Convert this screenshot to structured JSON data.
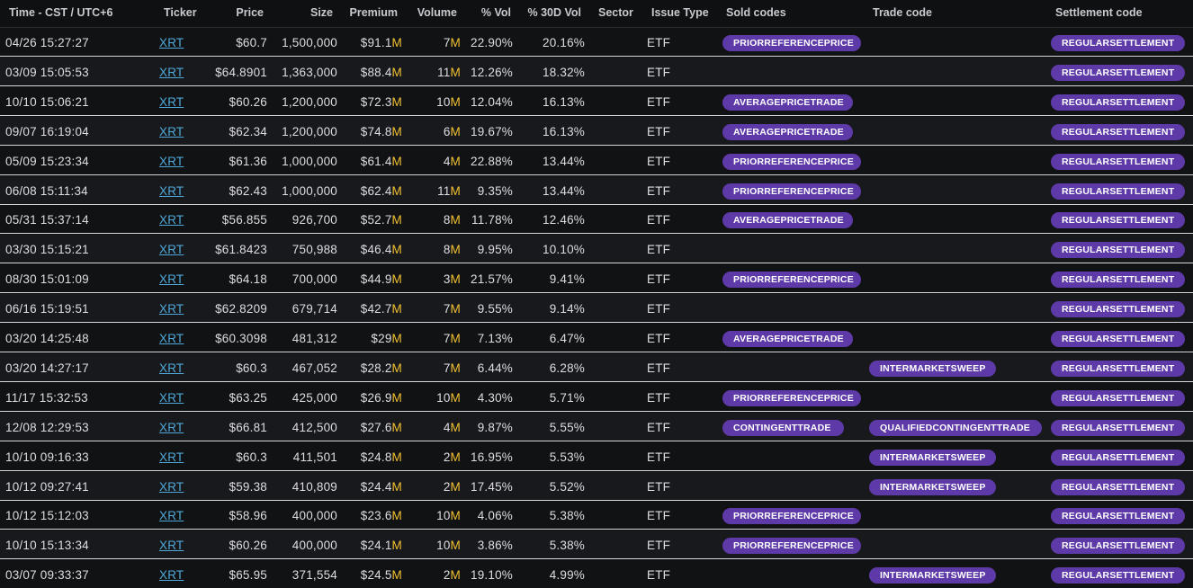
{
  "columns": {
    "time": "Time - CST / UTC+6",
    "ticker": "Ticker",
    "price": "Price",
    "size": "Size",
    "premium": "Premium",
    "volume": "Volume",
    "pct_vol": "% Vol",
    "pct_30d_vol": "% 30D Vol",
    "sector": "Sector",
    "issue_type": "Issue Type",
    "sold_codes": "Sold codes",
    "trade_code": "Trade code",
    "settlement_code": "Settlement code"
  },
  "rows": [
    {
      "time": "04/26 15:27:27",
      "ticker": "XRT",
      "price": "$60.7",
      "size": "1,500,000",
      "premium_num": "$91.1",
      "premium_unit": "M",
      "volume_num": "7",
      "volume_unit": "M",
      "pct_vol": "22.90%",
      "pct_30d": "20.16%",
      "sector": "",
      "issue_type": "ETF",
      "sold_code": "PRIORREFERENCEPRICE",
      "trade_code": "",
      "settlement_code": "REGULARSETTLEMENT"
    },
    {
      "time": "03/09 15:05:53",
      "ticker": "XRT",
      "price": "$64.8901",
      "size": "1,363,000",
      "premium_num": "$88.4",
      "premium_unit": "M",
      "volume_num": "11",
      "volume_unit": "M",
      "pct_vol": "12.26%",
      "pct_30d": "18.32%",
      "sector": "",
      "issue_type": "ETF",
      "sold_code": "",
      "trade_code": "",
      "settlement_code": "REGULARSETTLEMENT"
    },
    {
      "time": "10/10 15:06:21",
      "ticker": "XRT",
      "price": "$60.26",
      "size": "1,200,000",
      "premium_num": "$72.3",
      "premium_unit": "M",
      "volume_num": "10",
      "volume_unit": "M",
      "pct_vol": "12.04%",
      "pct_30d": "16.13%",
      "sector": "",
      "issue_type": "ETF",
      "sold_code": "AVERAGEPRICETRADE",
      "trade_code": "",
      "settlement_code": "REGULARSETTLEMENT"
    },
    {
      "time": "09/07 16:19:04",
      "ticker": "XRT",
      "price": "$62.34",
      "size": "1,200,000",
      "premium_num": "$74.8",
      "premium_unit": "M",
      "volume_num": "6",
      "volume_unit": "M",
      "pct_vol": "19.67%",
      "pct_30d": "16.13%",
      "sector": "",
      "issue_type": "ETF",
      "sold_code": "AVERAGEPRICETRADE",
      "trade_code": "",
      "settlement_code": "REGULARSETTLEMENT"
    },
    {
      "time": "05/09 15:23:34",
      "ticker": "XRT",
      "price": "$61.36",
      "size": "1,000,000",
      "premium_num": "$61.4",
      "premium_unit": "M",
      "volume_num": "4",
      "volume_unit": "M",
      "pct_vol": "22.88%",
      "pct_30d": "13.44%",
      "sector": "",
      "issue_type": "ETF",
      "sold_code": "PRIORREFERENCEPRICE",
      "trade_code": "",
      "settlement_code": "REGULARSETTLEMENT"
    },
    {
      "time": "06/08 15:11:34",
      "ticker": "XRT",
      "price": "$62.43",
      "size": "1,000,000",
      "premium_num": "$62.4",
      "premium_unit": "M",
      "volume_num": "11",
      "volume_unit": "M",
      "pct_vol": "9.35%",
      "pct_30d": "13.44%",
      "sector": "",
      "issue_type": "ETF",
      "sold_code": "PRIORREFERENCEPRICE",
      "trade_code": "",
      "settlement_code": "REGULARSETTLEMENT"
    },
    {
      "time": "05/31 15:37:14",
      "ticker": "XRT",
      "price": "$56.855",
      "size": "926,700",
      "premium_num": "$52.7",
      "premium_unit": "M",
      "volume_num": "8",
      "volume_unit": "M",
      "pct_vol": "11.78%",
      "pct_30d": "12.46%",
      "sector": "",
      "issue_type": "ETF",
      "sold_code": "AVERAGEPRICETRADE",
      "trade_code": "",
      "settlement_code": "REGULARSETTLEMENT"
    },
    {
      "time": "03/30 15:15:21",
      "ticker": "XRT",
      "price": "$61.8423",
      "size": "750,988",
      "premium_num": "$46.4",
      "premium_unit": "M",
      "volume_num": "8",
      "volume_unit": "M",
      "pct_vol": "9.95%",
      "pct_30d": "10.10%",
      "sector": "",
      "issue_type": "ETF",
      "sold_code": "",
      "trade_code": "",
      "settlement_code": "REGULARSETTLEMENT"
    },
    {
      "time": "08/30 15:01:09",
      "ticker": "XRT",
      "price": "$64.18",
      "size": "700,000",
      "premium_num": "$44.9",
      "premium_unit": "M",
      "volume_num": "3",
      "volume_unit": "M",
      "pct_vol": "21.57%",
      "pct_30d": "9.41%",
      "sector": "",
      "issue_type": "ETF",
      "sold_code": "PRIORREFERENCEPRICE",
      "trade_code": "",
      "settlement_code": "REGULARSETTLEMENT"
    },
    {
      "time": "06/16 15:19:51",
      "ticker": "XRT",
      "price": "$62.8209",
      "size": "679,714",
      "premium_num": "$42.7",
      "premium_unit": "M",
      "volume_num": "7",
      "volume_unit": "M",
      "pct_vol": "9.55%",
      "pct_30d": "9.14%",
      "sector": "",
      "issue_type": "ETF",
      "sold_code": "",
      "trade_code": "",
      "settlement_code": "REGULARSETTLEMENT"
    },
    {
      "time": "03/20 14:25:48",
      "ticker": "XRT",
      "price": "$60.3098",
      "size": "481,312",
      "premium_num": "$29",
      "premium_unit": "M",
      "volume_num": "7",
      "volume_unit": "M",
      "pct_vol": "7.13%",
      "pct_30d": "6.47%",
      "sector": "",
      "issue_type": "ETF",
      "sold_code": "AVERAGEPRICETRADE",
      "trade_code": "",
      "settlement_code": "REGULARSETTLEMENT"
    },
    {
      "time": "03/20 14:27:17",
      "ticker": "XRT",
      "price": "$60.3",
      "size": "467,052",
      "premium_num": "$28.2",
      "premium_unit": "M",
      "volume_num": "7",
      "volume_unit": "M",
      "pct_vol": "6.44%",
      "pct_30d": "6.28%",
      "sector": "",
      "issue_type": "ETF",
      "sold_code": "",
      "trade_code": "INTERMARKETSWEEP",
      "settlement_code": "REGULARSETTLEMENT"
    },
    {
      "time": "11/17 15:32:53",
      "ticker": "XRT",
      "price": "$63.25",
      "size": "425,000",
      "premium_num": "$26.9",
      "premium_unit": "M",
      "volume_num": "10",
      "volume_unit": "M",
      "pct_vol": "4.30%",
      "pct_30d": "5.71%",
      "sector": "",
      "issue_type": "ETF",
      "sold_code": "PRIORREFERENCEPRICE",
      "trade_code": "",
      "settlement_code": "REGULARSETTLEMENT"
    },
    {
      "time": "12/08 12:29:53",
      "ticker": "XRT",
      "price": "$66.81",
      "size": "412,500",
      "premium_num": "$27.6",
      "premium_unit": "M",
      "volume_num": "4",
      "volume_unit": "M",
      "pct_vol": "9.87%",
      "pct_30d": "5.55%",
      "sector": "",
      "issue_type": "ETF",
      "sold_code": "CONTINGENTTRADE",
      "trade_code": "QUALIFIEDCONTINGENTTRADE",
      "settlement_code": "REGULARSETTLEMENT"
    },
    {
      "time": "10/10 09:16:33",
      "ticker": "XRT",
      "price": "$60.3",
      "size": "411,501",
      "premium_num": "$24.8",
      "premium_unit": "M",
      "volume_num": "2",
      "volume_unit": "M",
      "pct_vol": "16.95%",
      "pct_30d": "5.53%",
      "sector": "",
      "issue_type": "ETF",
      "sold_code": "",
      "trade_code": "INTERMARKETSWEEP",
      "settlement_code": "REGULARSETTLEMENT"
    },
    {
      "time": "10/12 09:27:41",
      "ticker": "XRT",
      "price": "$59.38",
      "size": "410,809",
      "premium_num": "$24.4",
      "premium_unit": "M",
      "volume_num": "2",
      "volume_unit": "M",
      "pct_vol": "17.45%",
      "pct_30d": "5.52%",
      "sector": "",
      "issue_type": "ETF",
      "sold_code": "",
      "trade_code": "INTERMARKETSWEEP",
      "settlement_code": "REGULARSETTLEMENT"
    },
    {
      "time": "10/12 15:12:03",
      "ticker": "XRT",
      "price": "$58.96",
      "size": "400,000",
      "premium_num": "$23.6",
      "premium_unit": "M",
      "volume_num": "10",
      "volume_unit": "M",
      "pct_vol": "4.06%",
      "pct_30d": "5.38%",
      "sector": "",
      "issue_type": "ETF",
      "sold_code": "PRIORREFERENCEPRICE",
      "trade_code": "",
      "settlement_code": "REGULARSETTLEMENT"
    },
    {
      "time": "10/10 15:13:34",
      "ticker": "XRT",
      "price": "$60.26",
      "size": "400,000",
      "premium_num": "$24.1",
      "premium_unit": "M",
      "volume_num": "10",
      "volume_unit": "M",
      "pct_vol": "3.86%",
      "pct_30d": "5.38%",
      "sector": "",
      "issue_type": "ETF",
      "sold_code": "PRIORREFERENCEPRICE",
      "trade_code": "",
      "settlement_code": "REGULARSETTLEMENT"
    },
    {
      "time": "03/07 09:33:37",
      "ticker": "XRT",
      "price": "$65.95",
      "size": "371,554",
      "premium_num": "$24.5",
      "premium_unit": "M",
      "volume_num": "2",
      "volume_unit": "M",
      "pct_vol": "19.10%",
      "pct_30d": "4.99%",
      "sector": "",
      "issue_type": "ETF",
      "sold_code": "",
      "trade_code": "INTERMARKETSWEEP",
      "settlement_code": "REGULARSETTLEMENT"
    }
  ],
  "colors": {
    "background": "#111214",
    "row_alt": "#18191c",
    "pill": "#5e3aa8",
    "ticker_link": "#4fa8d8",
    "unit_accent": "#f2c232"
  }
}
